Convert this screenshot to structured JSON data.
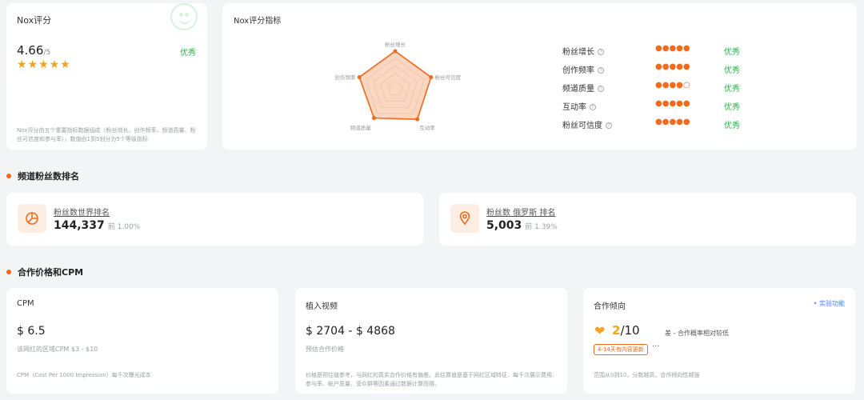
{
  "score": {
    "title": "Nox评分",
    "value": "4.66",
    "scale": "/5",
    "rating": "优秀",
    "stars": "★★★★★",
    "description": "Nox评分由五个重要指标数据组成（粉丝增长、创作频率、频道质量、粉丝可信度和参与率），数值由1到5划分为5个等级指标"
  },
  "metrics": {
    "title": "Nox评分指标",
    "radar_labels": [
      "粉丝增长",
      "粉丝可信度",
      "互动率",
      "频道质量",
      "创作频率"
    ],
    "radar_values": [
      4.9,
      4.9,
      4.9,
      4.7,
      4.9
    ],
    "rows": [
      {
        "label": "粉丝增长",
        "dots": "●●●●●",
        "grade": "优秀"
      },
      {
        "label": "创作频率",
        "dots": "●●●●●",
        "grade": "优秀"
      },
      {
        "label": "频道质量",
        "dots": "●●●●○",
        "grade": "优秀"
      },
      {
        "label": "互动率",
        "dots": "●●●●●",
        "grade": "优秀"
      },
      {
        "label": "粉丝可信度",
        "dots": "●●●●●",
        "grade": "优秀"
      }
    ]
  },
  "ranking": {
    "section_title": "频道粉丝数排名",
    "world": {
      "label": "粉丝数世界排名",
      "value": "144,337",
      "pct": "前 1.00%"
    },
    "country": {
      "label": "粉丝数 俄罗斯 排名",
      "value": "5,003",
      "pct": "前 1.39%"
    }
  },
  "pricing": {
    "section_title": "合作价格和CPM",
    "cpm": {
      "title": "CPM",
      "value": "$ 6.5",
      "sub": "该网红的区域CPM $3 - $10",
      "foot": "CPM（Cost Per 1000 Impression）每千次曝光成本"
    },
    "video": {
      "title": "植入视频",
      "value": "$ 2704 - $ 4868",
      "sub": "预估合作价格",
      "foot": "价格是预估值参考，与网红的真实合作价格有偏差。此估算值是基于网红区域特征、每千次展示费用、参与率、帐户质量、受众群等因素通过数据计算而得。"
    },
    "coop": {
      "title": "合作倾向",
      "lab": "• 实验功能",
      "score_main": "2",
      "score_scale": "/10",
      "note": "差 - 合作概率相对较低",
      "tag": "4-14天有内容更新",
      "more": "···",
      "foot": "范围从0到10，分数越高，合作倾向性越强"
    }
  }
}
